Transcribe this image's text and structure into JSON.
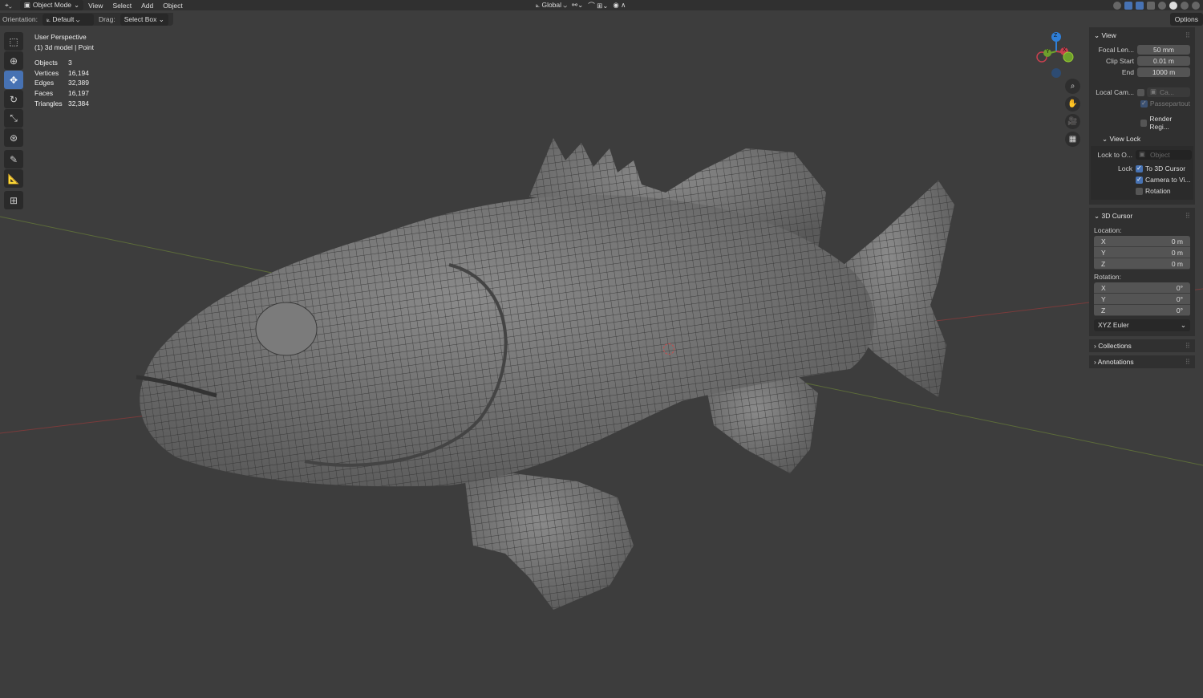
{
  "topbar": {
    "mode": "Object Mode",
    "menus": [
      "View",
      "Select",
      "Add",
      "Object"
    ],
    "transform_orientation": "Global"
  },
  "header2": {
    "orientation_label": "Orientation:",
    "orientation_value": "Default",
    "drag_label": "Drag:",
    "drag_value": "Select Box",
    "options": "Options"
  },
  "overlay": {
    "view_name": "User Perspective",
    "object_info": "(1) 3d model | Point",
    "stats": [
      [
        "Objects",
        "3"
      ],
      [
        "Vertices",
        "16,194"
      ],
      [
        "Edges",
        "32,389"
      ],
      [
        "Faces",
        "16,197"
      ],
      [
        "Triangles",
        "32,384"
      ]
    ]
  },
  "gizmo": {
    "x": "X",
    "y": "Y",
    "z": "Z",
    "colors": {
      "x": "#c8404f",
      "y": "#6ea02c",
      "z": "#2f7fd8"
    }
  },
  "panel": {
    "view": {
      "title": "View",
      "focal_label": "Focal Len...",
      "focal": "50 mm",
      "clip_start_label": "Clip Start",
      "clip_start": "0.01 m",
      "end_label": "End",
      "end": "1000 m",
      "local_cam_label": "Local Cam...",
      "local_cam_value": "Ca...",
      "passepartout": "Passepartout",
      "render_region": "Render Regi..."
    },
    "view_lock": {
      "title": "View Lock",
      "lock_to_label": "Lock to O...",
      "lock_to_placeholder": "Object",
      "lock_label": "Lock",
      "to_3d_cursor": "To 3D Cursor",
      "camera_to_view": "Camera to Vi...",
      "rotation": "Rotation"
    },
    "cursor": {
      "title": "3D Cursor",
      "location_label": "Location:",
      "location": [
        [
          "X",
          "0 m"
        ],
        [
          "Y",
          "0 m"
        ],
        [
          "Z",
          "0 m"
        ]
      ],
      "rotation_label": "Rotation:",
      "rotation": [
        [
          "X",
          "0°"
        ],
        [
          "Y",
          "0°"
        ],
        [
          "Z",
          "0°"
        ]
      ],
      "rotation_mode": "XYZ Euler"
    },
    "collections": "Collections",
    "annotations": "Annotations"
  },
  "accent": "#4772b3"
}
